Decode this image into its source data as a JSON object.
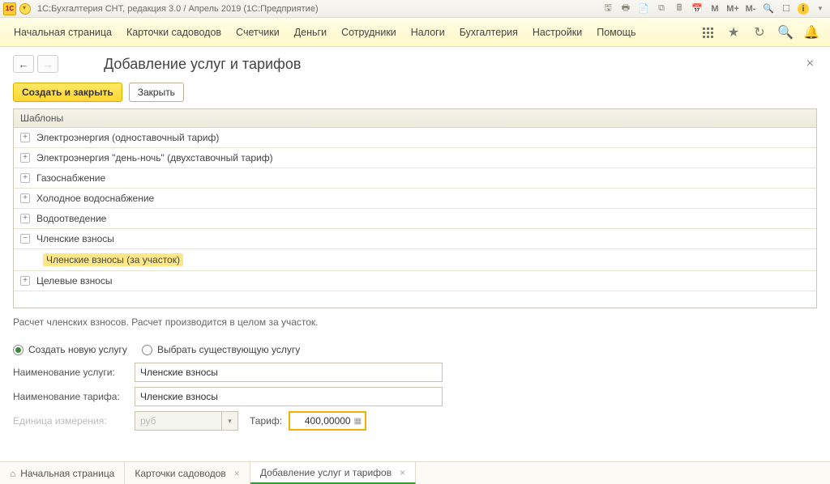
{
  "title_bar": {
    "app_title": "1С:Бухгалтерия СНТ, редакция 3.0 / Апрель 2019  (1С:Предприятие)"
  },
  "main_menu": {
    "items": [
      "Начальная страница",
      "Карточки садоводов",
      "Счетчики",
      "Деньги",
      "Сотрудники",
      "Налоги",
      "Бухгалтерия",
      "Настройки",
      "Помощь"
    ]
  },
  "page": {
    "heading": "Добавление услуг и тарифов",
    "create_and_close": "Создать и закрыть",
    "close": "Закрыть"
  },
  "templates": {
    "header": "Шаблоны",
    "rows": [
      {
        "label": "Электроэнергия (одноставочный тариф)",
        "expanded": false
      },
      {
        "label": "Электроэнергия \"день-ночь\" (двухставочный тариф)",
        "expanded": false
      },
      {
        "label": "Газоснабжение",
        "expanded": false
      },
      {
        "label": "Холодное водоснабжение",
        "expanded": false
      },
      {
        "label": "Водоотведение",
        "expanded": false
      },
      {
        "label": "Членские взносы",
        "expanded": true
      },
      {
        "label": "Целевые взносы",
        "expanded": false
      }
    ],
    "subitem": "Членские взносы (за участок)"
  },
  "description": "Расчет членских взносов. Расчет производится в целом за участок.",
  "radios": {
    "create_new": "Создать новую услугу",
    "choose_existing": "Выбрать существующую услугу"
  },
  "form": {
    "service_name_label": "Наименование услуги:",
    "service_name_value": "Членские взносы",
    "tariff_name_label": "Наименование тарифа:",
    "tariff_name_value": "Членские взносы",
    "unit_label": "Единица измерения:",
    "unit_value": "руб",
    "tarif_label": "Тариф:",
    "tarif_value": "400,00000"
  },
  "bottom_tabs": {
    "home": "Начальная страница",
    "t1": "Карточки садоводов",
    "t2": "Добавление услуг и тарифов"
  }
}
